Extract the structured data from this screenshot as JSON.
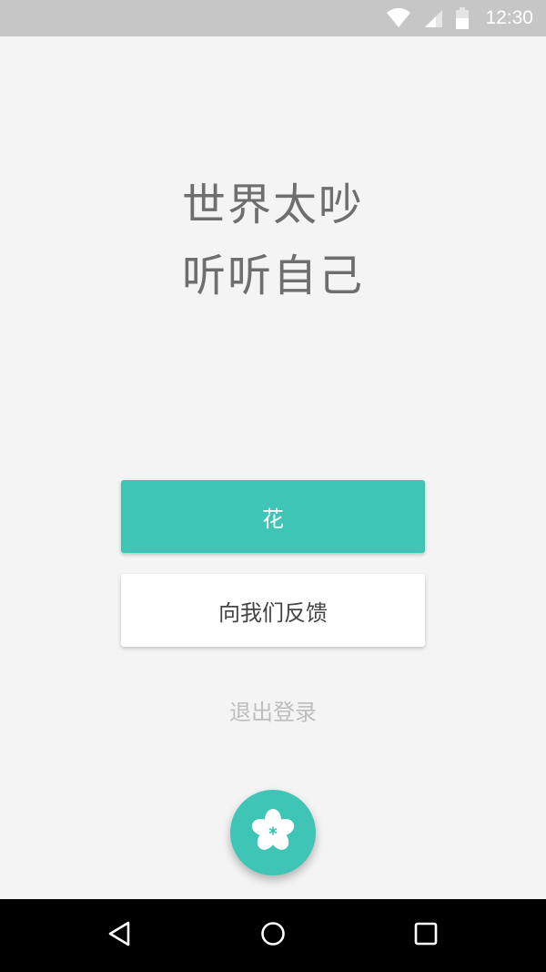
{
  "status_bar": {
    "time": "12:30",
    "icons": [
      "wifi-icon",
      "cell-signal-icon",
      "battery-icon"
    ]
  },
  "main": {
    "slogan_line1": "世界太吵",
    "slogan_line2": "听听自己",
    "primary_button_label": "花",
    "feedback_button_label": "向我们反馈",
    "logout_label": "退出登录",
    "fab_icon": "flower-icon"
  },
  "nav_bar": {
    "icons": [
      "back-icon",
      "home-icon",
      "recent-apps-icon"
    ]
  },
  "colors": {
    "accent": "#3ec5b5",
    "background": "#f4f4f4",
    "status_bar": "#c6c6c6",
    "nav_bar": "#000000"
  }
}
